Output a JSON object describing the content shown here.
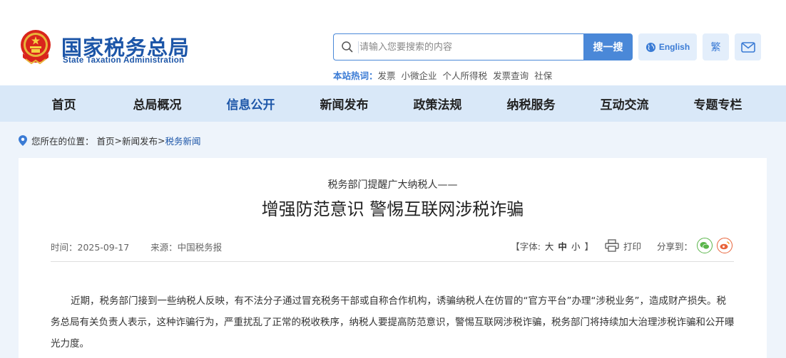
{
  "header": {
    "logo_cn": "国家税务总局",
    "logo_en": "State Taxation Administration",
    "search": {
      "placeholder": "请输入您要搜索的内容",
      "button_label": "搜一搜",
      "icon": "search-icon"
    },
    "english_label": "English",
    "traditional_label": "繁",
    "mail_icon": "mail-icon",
    "hotwords": {
      "label": "本站热词：",
      "items": [
        "发票",
        "小微企业",
        "个人所得税",
        "发票查询",
        "社保"
      ]
    }
  },
  "nav": {
    "items": [
      {
        "label": "首页"
      },
      {
        "label": "总局概况"
      },
      {
        "label": "信息公开"
      },
      {
        "label": "新闻发布"
      },
      {
        "label": "政策法规"
      },
      {
        "label": "纳税服务"
      },
      {
        "label": "互动交流"
      },
      {
        "label": "专题专栏"
      }
    ],
    "active_index": 2
  },
  "breadcrumb": {
    "prefix": "您所在的位置：",
    "items": [
      "首页",
      "新闻发布",
      "税务新闻"
    ],
    "separator": ">"
  },
  "article": {
    "subtitle": "税务部门提醒广大纳税人——",
    "title": "增强防范意识 警惕互联网涉税诈骗",
    "time": "时间：2025-09-17",
    "source": "来源：中国税务报",
    "font_label": "【字体:",
    "font_large": "大",
    "font_mid": "中",
    "font_small": "小",
    "font_close": "】",
    "print_label": "打印",
    "share_label": "分享到：",
    "paragraph": "近期，税务部门接到一些纳税人反映，有不法分子通过冒充税务干部或自称合作机构，诱骗纳税人在仿冒的“官方平台”办理“涉税业务”，造成财产损失。税务总局有关负责人表示，这种诈骗行为，严重扰乱了正常的税收秩序，纳税人要提高防范意识，警惕互联网涉税诈骗，税务部门将持续加大治理涉税诈骗和公开曝光力度。"
  },
  "colors": {
    "brand_blue": "#1d56a8",
    "accent_blue": "#4a88d8",
    "nav_bg": "#d9e8f8",
    "page_bg": "#eef4fb"
  }
}
